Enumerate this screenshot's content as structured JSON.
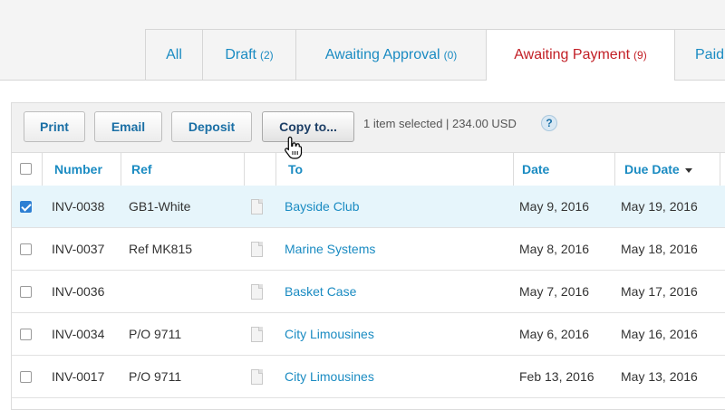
{
  "tabs": [
    {
      "label": "All",
      "count": ""
    },
    {
      "label": "Draft",
      "count": "(2)"
    },
    {
      "label": "Awaiting Approval",
      "count": "(0)"
    },
    {
      "label": "Awaiting Payment",
      "count": "(9)",
      "active": true
    },
    {
      "label": "Paid",
      "count": ""
    }
  ],
  "toolbar": {
    "print_label": "Print",
    "email_label": "Email",
    "deposit_label": "Deposit",
    "copy_label": "Copy to...",
    "selection_info": "1 item selected | 234.00 USD",
    "help_label": "?"
  },
  "table": {
    "columns": {
      "number": "Number",
      "ref": "Ref",
      "to": "To",
      "date": "Date",
      "due_date": "Due Date"
    },
    "rows": [
      {
        "checked": true,
        "number": "INV-0038",
        "ref": "GB1-White",
        "to": "Bayside Club",
        "date": "May 9, 2016",
        "due": "May 19, 2016"
      },
      {
        "checked": false,
        "number": "INV-0037",
        "ref": "Ref MK815",
        "to": "Marine Systems",
        "date": "May 8, 2016",
        "due": "May 18, 2016"
      },
      {
        "checked": false,
        "number": "INV-0036",
        "ref": "",
        "to": "Basket Case",
        "date": "May 7, 2016",
        "due": "May 17, 2016"
      },
      {
        "checked": false,
        "number": "INV-0034",
        "ref": "P/O 9711",
        "to": "City Limousines",
        "date": "May 6, 2016",
        "due": "May 16, 2016"
      },
      {
        "checked": false,
        "number": "INV-0017",
        "ref": "P/O 9711",
        "to": "City Limousines",
        "date": "Feb 13, 2016",
        "due": "May 13, 2016"
      }
    ]
  },
  "colors": {
    "link": "#1a8bc2",
    "active_tab": "#c21e25",
    "selected_row": "#e6f5fb",
    "checkbox_checked": "#2d7fd3"
  }
}
